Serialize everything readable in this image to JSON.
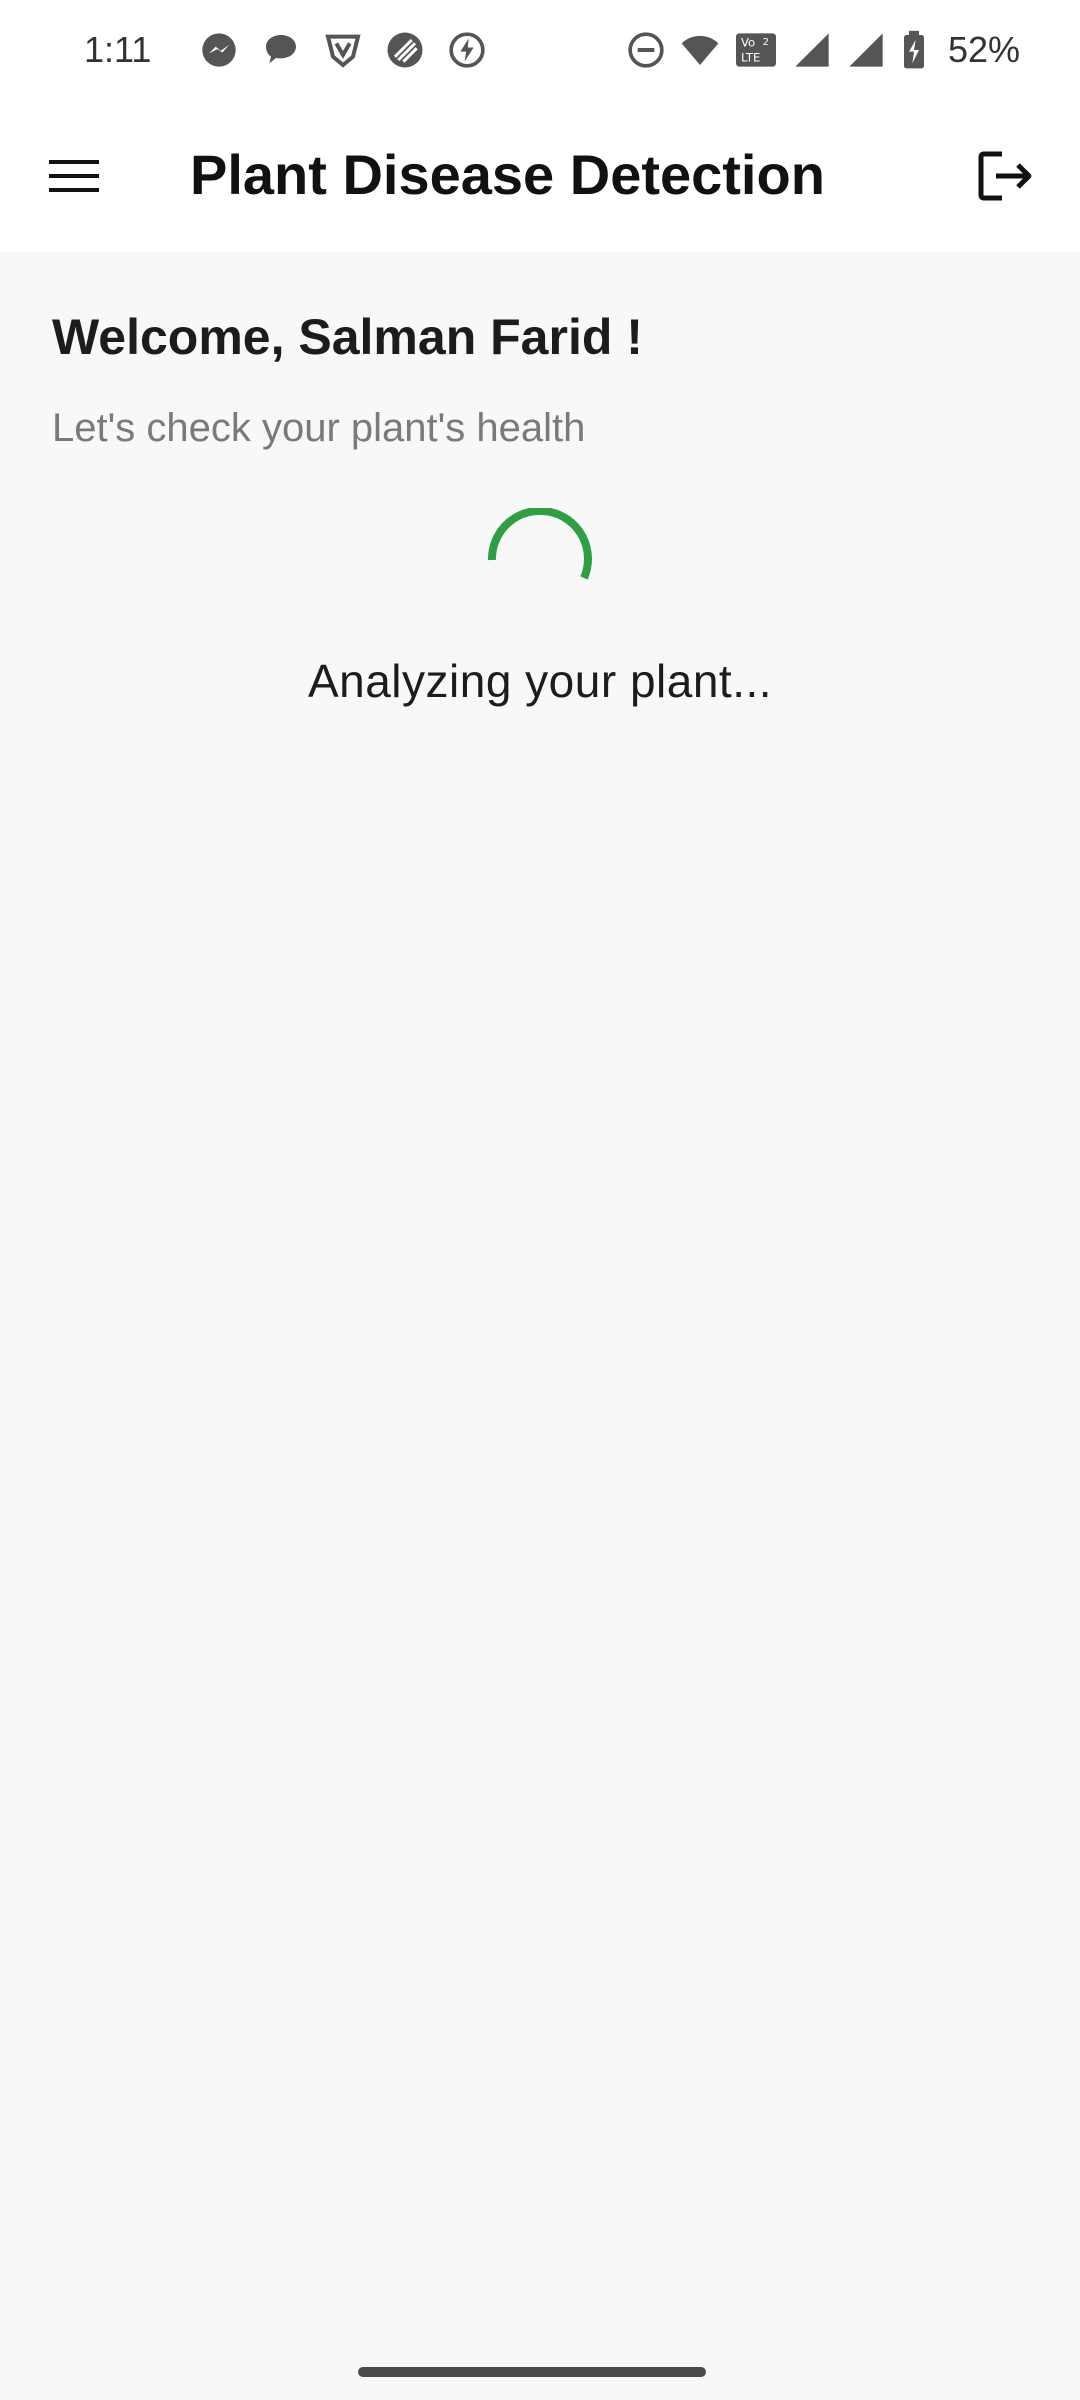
{
  "status_bar": {
    "time": "1:11",
    "battery_percent": "52%",
    "left_icons": [
      "messenger-icon",
      "chat-bubble-icon",
      "shield-v-icon",
      "stripes-app-icon",
      "bolt-circle-icon"
    ],
    "right_icons": [
      "do-not-disturb-icon",
      "wifi-icon",
      "volte-icon",
      "signal-icon",
      "signal-icon",
      "battery-charging-icon"
    ]
  },
  "app_bar": {
    "title": "Plant Disease Detection",
    "menu_icon": "hamburger-menu-icon",
    "logout_icon": "logout-icon"
  },
  "main": {
    "welcome": "Welcome, Salman Farid !",
    "subtitle": "Let's check your plant's health",
    "loading_text": "Analyzing your plant..."
  },
  "colors": {
    "accent": "#2ea043",
    "background": "#f8f8f8",
    "app_bar": "#ffffff"
  }
}
